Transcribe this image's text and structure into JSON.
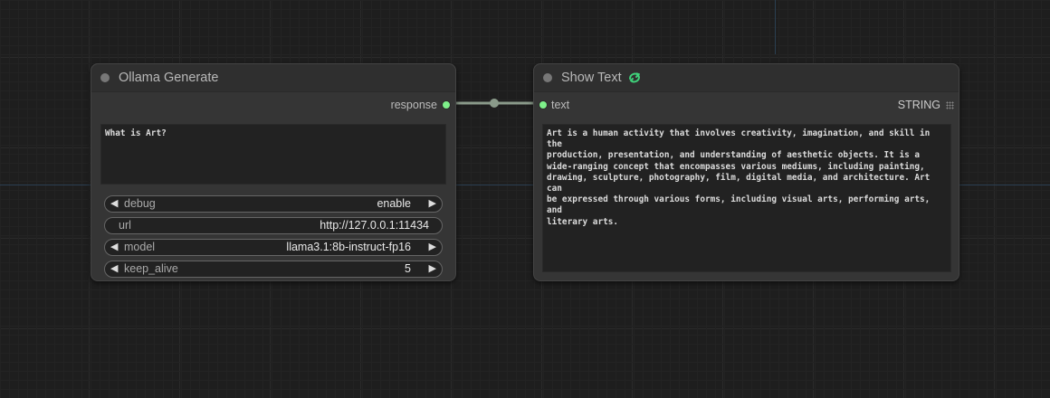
{
  "nodes": {
    "ollama_generate": {
      "title": "Ollama Generate",
      "output_label": "response",
      "prompt_text": "What is Art?",
      "widgets": {
        "debug": {
          "label": "debug",
          "value": "enable"
        },
        "url": {
          "label": "url",
          "value": "http://127.0.0.1:11434"
        },
        "model": {
          "label": "model",
          "value": "llama3.1:8b-instruct-fp16"
        },
        "keep_alive": {
          "label": "keep_alive",
          "value": "5"
        }
      }
    },
    "show_text": {
      "title": "Show Text",
      "input_label": "text",
      "output_type": "STRING",
      "output_text": "Art is a human activity that involves creativity, imagination, and skill in the\nproduction, presentation, and understanding of aesthetic objects. It is a\nwide-ranging concept that encompasses various mediums, including painting,\ndrawing, sculpture, photography, film, digital media, and architecture. Art can\nbe expressed through various forms, including visual arts, performing arts, and\nliterary arts."
    }
  },
  "colors": {
    "canvas": "#1e1e1e",
    "node_body": "#353535",
    "slot_connected": "#7ef08a",
    "link": "#8a9a8a",
    "badge": "#3fd17a"
  },
  "icons": {
    "left_arrow": "◀",
    "right_arrow": "▶"
  }
}
